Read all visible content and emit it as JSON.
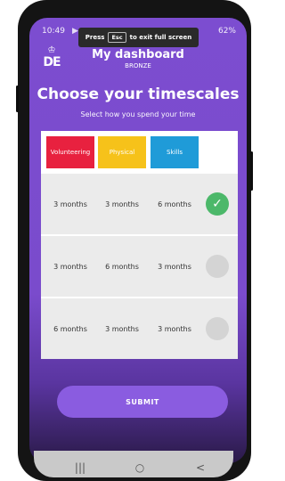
{
  "status_bar": {
    "time": "10:49",
    "icons": "▶ ◧ ◫",
    "battery": "62%"
  },
  "fullscreen_toast": {
    "press": "Press",
    "key": "Esc",
    "message": "to exit full screen"
  },
  "logo": {
    "text": "DE"
  },
  "header": {
    "title": "My dashboard",
    "level": "BRONZE"
  },
  "main": {
    "heading": "Choose your timescales",
    "subheading": "Select how you spend your time"
  },
  "legend": [
    {
      "label": "Volunteering",
      "color": "#e8213f"
    },
    {
      "label": "Physical",
      "color": "#f6c21a"
    },
    {
      "label": "Skills",
      "color": "#1f9bd8"
    }
  ],
  "options": [
    {
      "volunteering": "3 months",
      "physical": "3 months",
      "skills": "6 months",
      "selected": true
    },
    {
      "volunteering": "3 months",
      "physical": "6 months",
      "skills": "3 months",
      "selected": false
    },
    {
      "volunteering": "6 months",
      "physical": "3 months",
      "skills": "3 months",
      "selected": false
    }
  ],
  "submit_label": "SUBMIT",
  "navbar": {
    "recent": "|||",
    "home": "○",
    "back": "<"
  },
  "colors": {
    "accent": "#7c4dd0",
    "selected": "#4cb86a",
    "button": "#8a5ce0"
  }
}
